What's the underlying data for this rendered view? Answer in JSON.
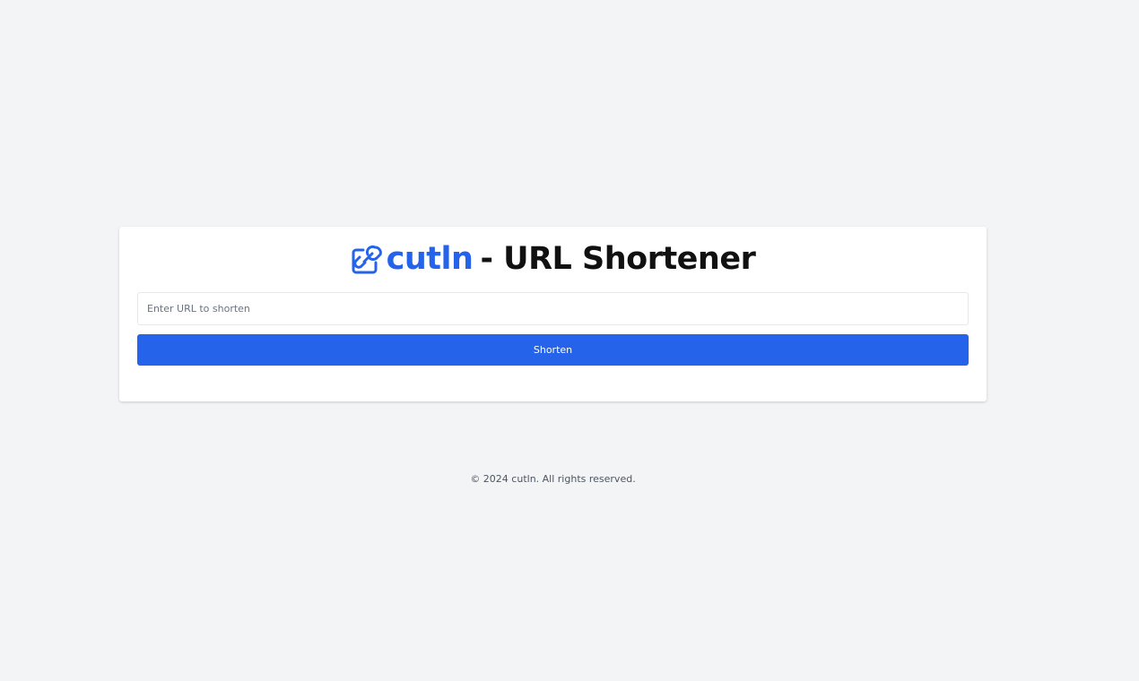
{
  "header": {
    "brand": "cutln",
    "title_suffix": "- URL Shortener",
    "logo_icon": "link-icon",
    "brand_color": "#2563eb"
  },
  "form": {
    "url_placeholder": "Enter URL to shorten",
    "url_value": "",
    "submit_label": "Shorten",
    "button_color": "#2563eb"
  },
  "footer": {
    "copyright": "© 2024 cutln. All rights reserved."
  }
}
